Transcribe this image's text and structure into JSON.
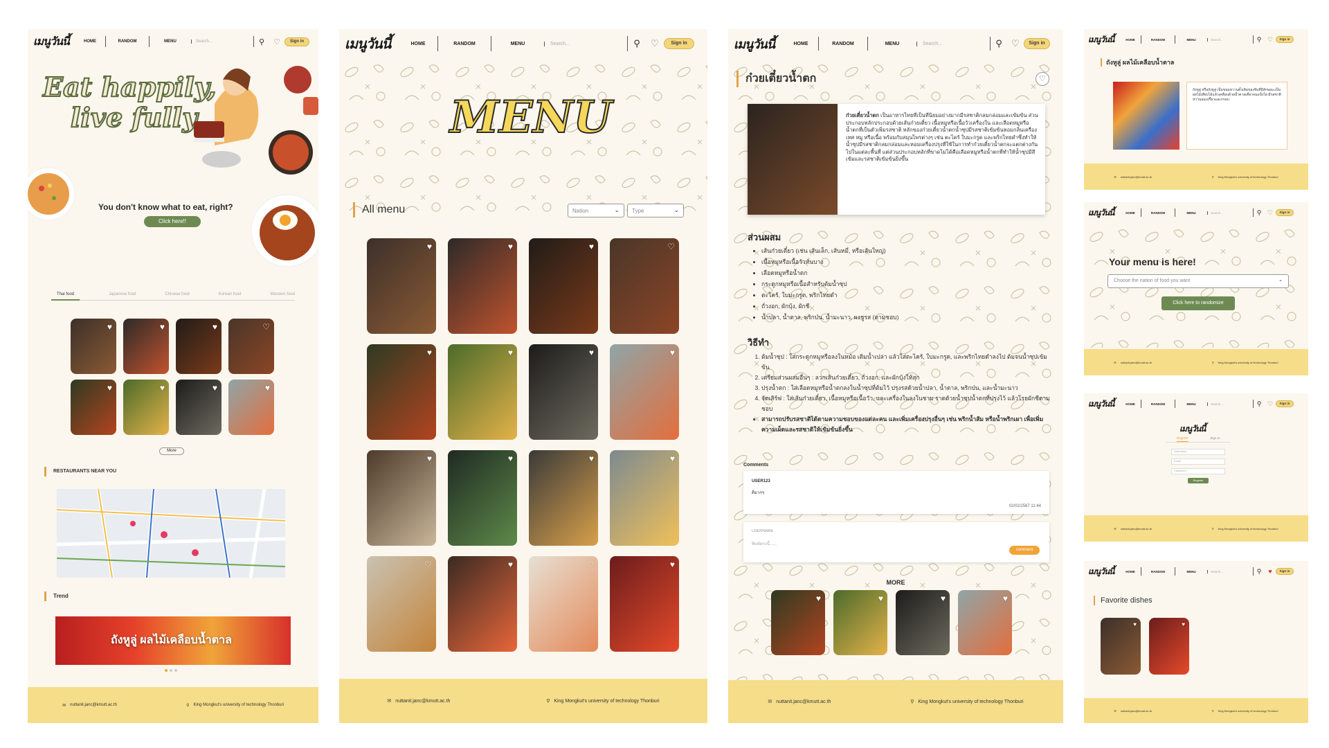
{
  "brand": {
    "logo": "เมนูวันนี้"
  },
  "nav": {
    "home": "HOME",
    "random": "RANDOM",
    "menu": "MENU",
    "search_placeholder": "Search...",
    "signin": "Sign in"
  },
  "footer": {
    "email": "nuttanit.janc@kmutt.ac.th",
    "location": "King Mongkut's university of technology Thonburi"
  },
  "home": {
    "hero_line1": "Eat happily,",
    "hero_line2": "live fully",
    "question": "You don't know what to eat, right?",
    "click_here": "Click here!!",
    "tabs": [
      "Thai food",
      "Japanese food",
      "Chinese food",
      "Korean food",
      "Western food"
    ],
    "active_tab": "Thai food",
    "more": "More",
    "restaurants_title": "RESTAURANTS NEAR YOU",
    "trend_title": "Trend",
    "trend_banner": "ถังหูลู่ ผลไม้เคลือบน้ำตาล"
  },
  "menu_page": {
    "banner": "MENU",
    "title": "All menu",
    "filter_nation": "Nation",
    "filter_type": "Type"
  },
  "detail": {
    "title": "ก๋วยเตี๋ยวน้ำตก",
    "desc_lead": "ก๋วยเตี๋ยวน้ำตก",
    "description": " เป็นอาหารไทยที่เป็นที่นิยมอย่างมากมีรสชาติกลมกล่อมและเข้มข้น ส่วนประกอบหลักประกอบด้วยเส้นก๋วยเตี๋ยว เนื้อหมูหรือเนื้อวัวเครื่องใน และเลือดหมูหรือน้ำตกที่เป็นตัวเพิ่มรสชาติ หลักของก๋วยเตี๋ยวน้ำตกน้ำซุปมีรสชาติเข้มข้นหอมกลิ่นเครื่องเทศ หมู หรือเนื้อ พร้อมกับสมุนไพรต่างๆ เช่น ตะไคร้ ใบมะกรูด และพริกไทยดำซึ่งทำให้น้ำซุปมีรสชาติกลมกล่อมและหอมเครื่องปรุงที่ใช้ในการทำก๋วยเตี๋ยวน้ำตกจะแตกต่างกันไปในแต่ละพื้นที่ แต่ส่วนประกอบหลักที่ขาดไม่ได้คือเลือดหมูหรือน้ำตกที่ทำให้น้ำซุปมีสีเข้มและรสชาติเข้มข้นยิ่งขึ้น",
    "ingredients_title": "ส่วนผสม",
    "ingredients": [
      "เส้นก๋วยเตี๋ยว (เช่น เส้นเล็ก, เส้นหมี่, หรือเส้นใหญ่)",
      "เนื้อหมูหรือเนื้อวัวหั่นบาง",
      "เลือดหมูหรือน้ำตก",
      "กระดูกหมูหรือเนื้อสำหรับต้มน้ำซุป",
      "ตะไคร้, ใบมะกรูด, พริกไทยดำ",
      "ถั่วงอก, ผักบุ้ง, ผักชี",
      "น้ำปลา, น้ำตาล, พริกป่น, น้ำมะนาว, ผงชูรส (ตามชอบ)"
    ],
    "method_title": "วิธีทำ",
    "steps": [
      "ต้มน้ำซุป : ใส่กระดูกหมูหรือลงในหม้อ เติมน้ำเปล่า แล้วใส่ตะไคร้, ใบมะกรูด, และพริกไทยดำลงไป ต้มจนน้ำซุปเข้มข้น",
      "เตรียมส่วนผสมอื่นๆ : ลวกเส้นก๋วยเตี๋ยว, ถั่วงอก, และผักบุ้งให้สุก",
      "ปรุงน้ำตก : ใส่เลือดหมูหรือน้ำตกลงในน้ำซุปที่ต้มไว้ ปรุงรสด้วยน้ำปลา, น้ำตาล, พริกป่น, และน้ำมะนาว",
      "จัดเสิร์ฟ : ใส่เส้นก๋วยเตี๋ยว, เนื้อหมูหรือเนื้อวัว, และเครื่องในลงในชาม ราดด้วยน้ำซุปน้ำตกที่ปรุงไว้ แล้วโรยผักชีตามชอบ"
    ],
    "tip": "สามารถปรับรสชาติได้ตามความชอบของแต่ละคน และเพิ่มเครื่องปรุงอื่นๆ เช่น พริกน้ำส้ม หรือน้ำพริกเผา เพื่อเพิ่มความเผ็ดและรสชาติให้เข้มข้นยิ่งขึ้น",
    "comments_label": "Comments",
    "comment_user": "USER123",
    "comment_text": "ดีมากๆ",
    "comment_time": "02/02/2567  11:44",
    "username_label": "USERNAME",
    "input_placeholder": "พิมพ์ตรงนี้......",
    "comment_btn": "comment",
    "more_label": "MORE"
  },
  "mini_trend": {
    "title": "ถังหูลู่ ผลไม้เคลือบน้ำตาล",
    "desc": "ถังหูลู่ หรือถังหูลู่ เป็นขนมหวานดั้งเดิมของจีนที่มีลักษณะเป็นผลไม้เสียบไม้แล้วเคลือบด้วยน้ำตาลเคี่ยวจนแข็งใส มีรสชาติหวานอมเปรี้ยวและกรอบ"
  },
  "mini_random": {
    "title": "Your menu is here!",
    "select_placeholder": "Choose the nation of food you want",
    "button": "Click here to randomize"
  },
  "mini_auth": {
    "tab_register": "Register",
    "tab_signin": "Sign in",
    "field_username": "Username",
    "field_email": "Email",
    "field_password": "Password",
    "button": "Register"
  },
  "mini_fav": {
    "title": "Favorite dishes"
  },
  "colors": {
    "cream": "#fbf7ee",
    "footer": "#f5dd8a",
    "accent": "#f3d57a",
    "green": "#6e8a53",
    "orange": "#f0a436"
  }
}
